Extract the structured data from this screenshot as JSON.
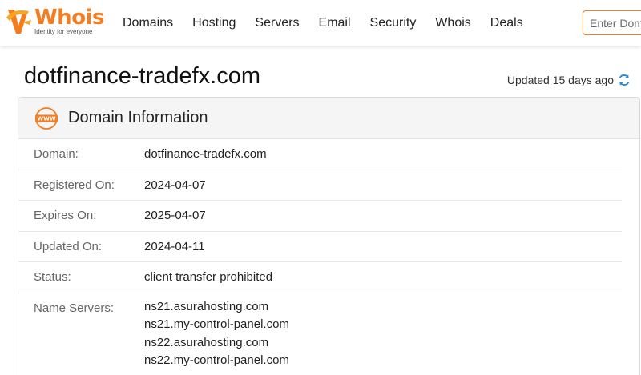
{
  "brand": {
    "name": "Whois",
    "tagline": "Identity for everyone",
    "color": "#f57c1f"
  },
  "nav": {
    "items": [
      "Domains",
      "Hosting",
      "Servers",
      "Email",
      "Security",
      "Whois",
      "Deals"
    ]
  },
  "search": {
    "placeholder": "Enter Domain"
  },
  "page": {
    "title": "dotfinance-tradefx.com",
    "updated": "Updated 15 days ago",
    "refresh_icon": "refresh-icon"
  },
  "panel": {
    "title": "Domain Information",
    "icon": "www-icon",
    "rows": [
      {
        "label": "Domain:",
        "value": "dotfinance-tradefx.com"
      },
      {
        "label": "Registered On:",
        "value": "2024-04-07"
      },
      {
        "label": "Expires On:",
        "value": "2025-04-07"
      },
      {
        "label": "Updated On:",
        "value": "2024-04-11"
      },
      {
        "label": "Status:",
        "value": "client transfer prohibited"
      }
    ],
    "name_servers": {
      "label": "Name Servers:",
      "values": [
        "ns21.asurahosting.com",
        "ns21.my-control-panel.com",
        "ns22.asurahosting.com",
        "ns22.my-control-panel.com"
      ]
    }
  }
}
